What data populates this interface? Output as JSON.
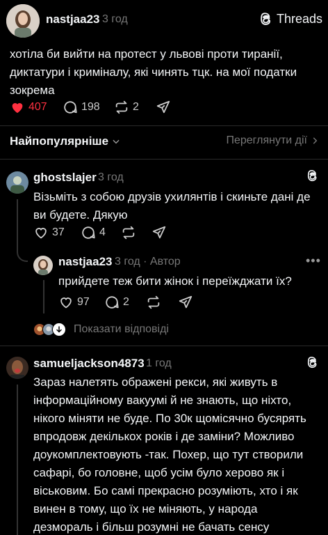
{
  "post": {
    "author": "nastjaa23",
    "time": "3 год",
    "brand": "Threads",
    "text": "хотіла би вийти на протест у львові проти тиранії, диктатури і криміналу, які чинять тцк. на мої податки зокрема",
    "likes": "407",
    "replies": "198",
    "reposts": "2"
  },
  "filter": {
    "sort_label": "Найпопулярніше",
    "activity_label": "Переглянути дії"
  },
  "comments": [
    {
      "author": "ghostslajer",
      "time": "3 год",
      "text": "Візьміть з собою друзів ухилянтів і скиньте дані де ви будете. Дякую",
      "likes": "37",
      "replies": "4"
    },
    {
      "author": "nastjaa23",
      "meta": "3 год · Автор",
      "text": "прийдете теж бити жінок і переїжджати їх?",
      "likes": "97",
      "replies": "2",
      "show_replies": "Показати відповіді"
    },
    {
      "author": "samueljackson4873",
      "time": "1 год",
      "text": "Зараз налетять ображені рекси, які живуть в інформаційному вакуумі й не знають, що ніхто, нікого міняти не буде. По 30к щомісячно бусярять впродовж декількох років і де заміни? Можливо доукомплектовують -так. Похер, що тут створили сафарі, бо головне, щоб усім було херово як і віськовим. Бо самі прекрасно розуміють, хто і як винен в тому, що їх не міняють, у народа дезмораль і більш розумні не бачать сенсу воювати за другу рашку, тільки іншою мовою."
    }
  ],
  "colors": {
    "like": "#ff3040",
    "muted": "#777777",
    "background": "#000000"
  }
}
